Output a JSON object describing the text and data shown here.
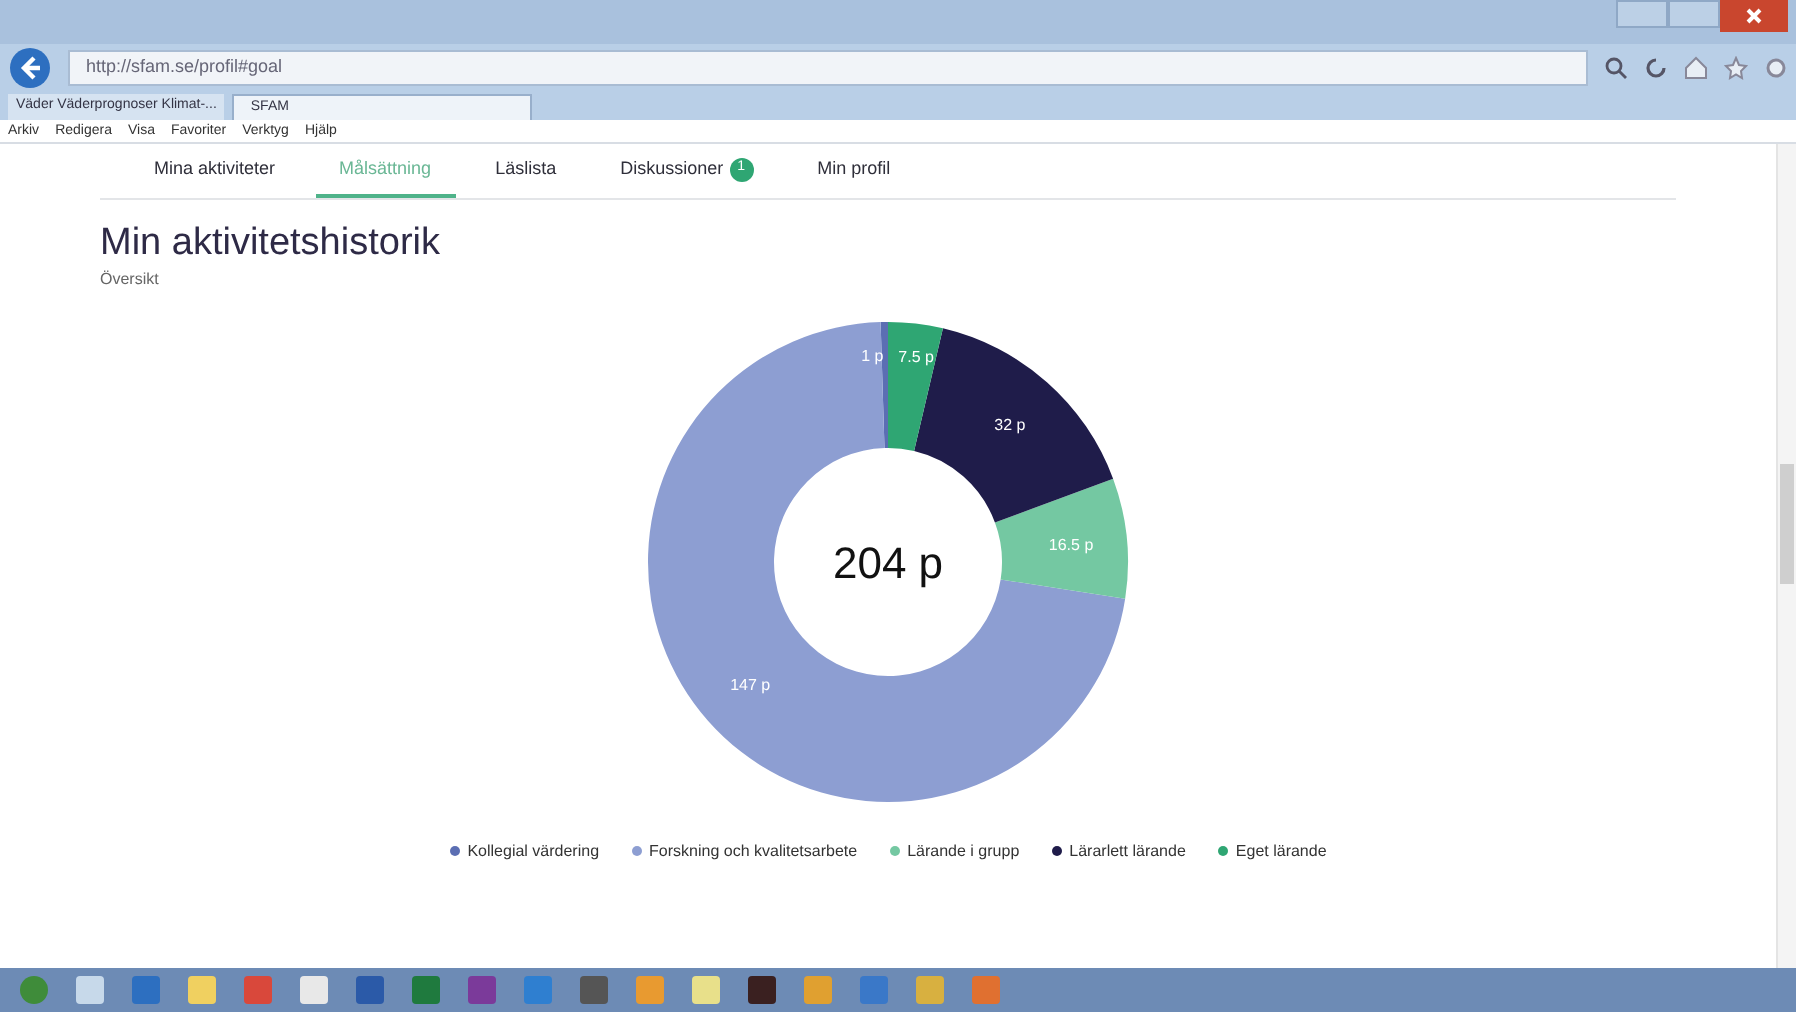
{
  "browser": {
    "address": "http://sfam.se/profil#goal",
    "tabs": [
      {
        "label": "Väder Väderprognoser Klimat-...",
        "selected": false
      },
      {
        "label": "SFAM",
        "selected": true
      }
    ],
    "menu": [
      "Arkiv",
      "Redigera",
      "Visa",
      "Favoriter",
      "Verktyg",
      "Hjälp"
    ]
  },
  "nav": [
    {
      "label": "Mina aktiviteter",
      "selected": false
    },
    {
      "label": "Målsättning",
      "selected": true
    },
    {
      "label": "Läslista",
      "selected": false
    },
    {
      "label": "Diskussioner",
      "selected": false,
      "badge": "1"
    },
    {
      "label": "Min profil",
      "selected": false
    }
  ],
  "heading": "Min aktivitetshistorik",
  "subheading": "Översikt",
  "total": "204 p",
  "chart_data": {
    "type": "donut",
    "categories": [
      "Kollegial värdering",
      "Forskning och kvalitetsarbete",
      "Lärande i grupp",
      "Lärarlett lärande",
      "Eget lärande"
    ],
    "values": [
      1,
      147,
      16.5,
      32,
      7.5
    ],
    "colors": [
      "#5b6eb3",
      "#8d9ed2",
      "#74c8a2",
      "#1f1c4a",
      "#2fa673"
    ],
    "value_labels": [
      "1 p",
      "147 p",
      "16.5 p",
      "32 p",
      "7.5 p"
    ]
  }
}
